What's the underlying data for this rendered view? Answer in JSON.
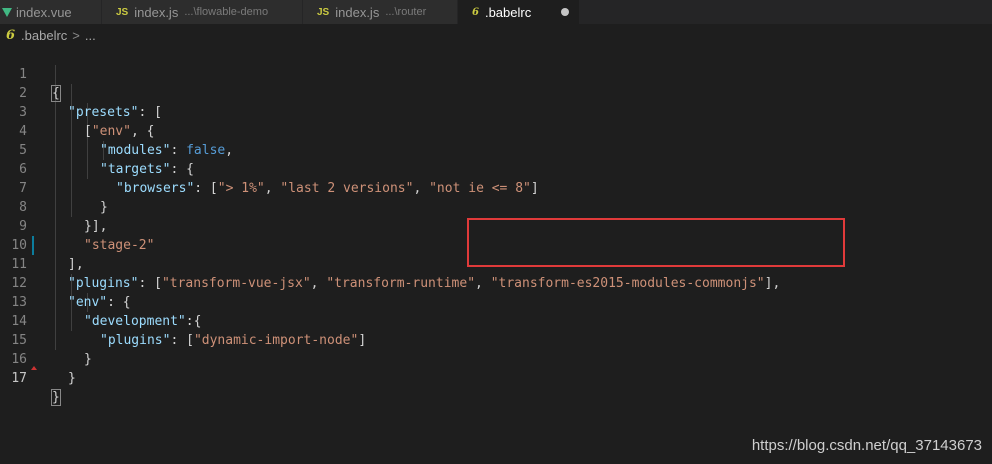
{
  "tabs": [
    {
      "name": "index.vue",
      "icon": "vue-icon",
      "desc": ""
    },
    {
      "name": "index.js",
      "icon": "js-icon",
      "icon_text": "JS",
      "desc": "...\\flowable-demo"
    },
    {
      "name": "index.js",
      "icon": "js-icon",
      "icon_text": "JS",
      "desc": "...\\router"
    },
    {
      "name": ".babelrc",
      "icon": "babel-icon",
      "icon_text": "6",
      "desc": "",
      "active": true,
      "dirty": true
    }
  ],
  "breadcrumb": {
    "icon_text": "6",
    "file": ".babelrc",
    "separator": ">",
    "rest": "..."
  },
  "editor": {
    "current_line": 17,
    "line_numbers": [
      "1",
      "2",
      "3",
      "4",
      "5",
      "6",
      "7",
      "8",
      "9",
      "10",
      "11",
      "12",
      "13",
      "14",
      "15",
      "16",
      "17"
    ],
    "tokens": {
      "l1": {
        "p1": "{"
      },
      "l2": {
        "k1": "\"presets\"",
        "p1": ": ["
      },
      "l3": {
        "p1": "[",
        "s1": "\"env\"",
        "p2": ", {"
      },
      "l4": {
        "k1": "\"modules\"",
        "p1": ": ",
        "b1": "false",
        "p2": ","
      },
      "l5": {
        "k1": "\"targets\"",
        "p1": ": {"
      },
      "l6": {
        "k1": "\"browsers\"",
        "p1": ": [",
        "s1": "\"> 1%\"",
        "p2": ", ",
        "s2": "\"last 2 versions\"",
        "p3": ", ",
        "s3": "\"not ie <= 8\"",
        "p4": "]"
      },
      "l7": {
        "p1": "}"
      },
      "l8": {
        "p1": "}],"
      },
      "l9": {
        "s1": "\"stage-2\""
      },
      "l10": {
        "p1": "],"
      },
      "l11": {
        "k1": "\"plugins\"",
        "p1": ": [",
        "s1": "\"transform-vue-jsx\"",
        "p2": ", ",
        "s2": "\"transform-runtime\"",
        "p3": ", ",
        "s3": "\"transform-es2015-modules-commonjs\"",
        "p4": "],"
      },
      "l12": {
        "k1": "\"env\"",
        "p1": ": {"
      },
      "l13": {
        "k1": "\"development\"",
        "p1": ":{"
      },
      "l14": {
        "k1": "\"plugins\"",
        "p1": ": [",
        "s1": "\"dynamic-import-node\"",
        "p2": "]"
      },
      "l15": {
        "p1": "}"
      },
      "l16": {
        "p1": "}"
      },
      "l17": {
        "p1": "}"
      }
    }
  },
  "colors": {
    "background": "#1e1e1e",
    "key": "#9cdcfe",
    "string": "#ce9178",
    "boolean": "#569cd6",
    "highlight_box": "#e03a3a"
  },
  "watermark": "https://blog.csdn.net/qq_37143673"
}
